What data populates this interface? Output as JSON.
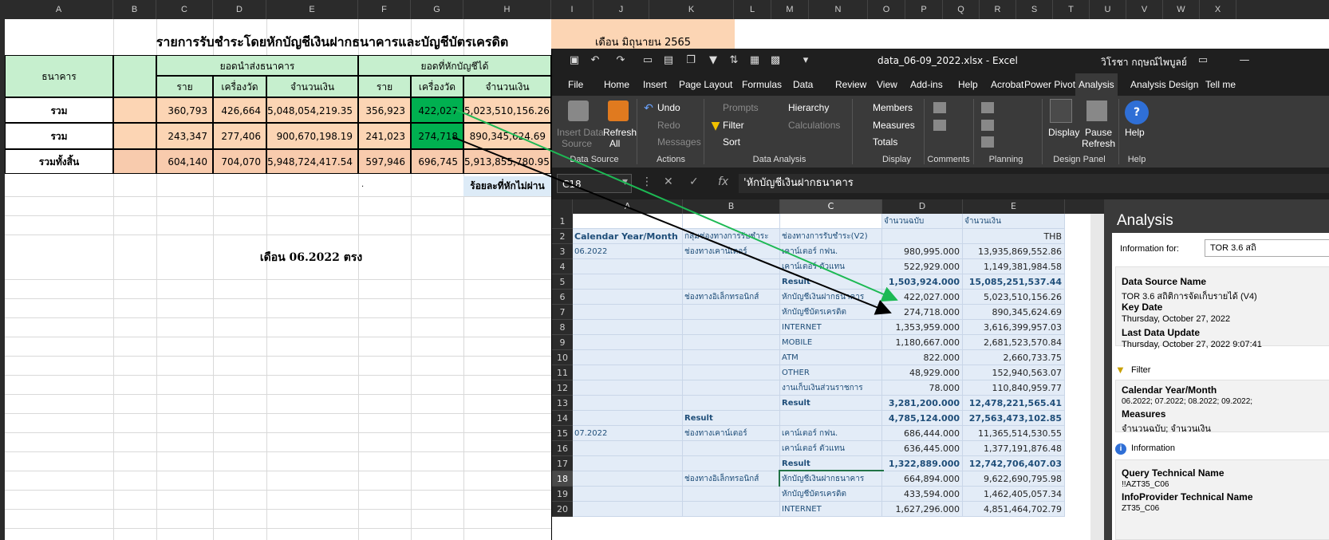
{
  "sheet": {
    "col_headers": [
      "A",
      "B",
      "C",
      "D",
      "E",
      "F",
      "G",
      "H",
      "I",
      "J",
      "K",
      "L",
      "M",
      "N",
      "O",
      "P",
      "Q",
      "R",
      "S",
      "T",
      "U",
      "V",
      "W",
      "X"
    ],
    "title": "รายการรับชำระโดยหักบัญชีเงินฝากธนาคารและบัญชีบัตรเครดิต",
    "month_box": "เดือน มิถุนายน  2565",
    "hdr_bank": "ธนาคาร",
    "hdr_sent": "ยอดนำส่งธนาคาร",
    "hdr_deducted": "ยอดที่หักบัญชีได้",
    "sub_rai": "ราย",
    "sub_machine": "เครื่องวัด",
    "sub_amount": "จำนวนเงิน",
    "rows": [
      {
        "label": "รวม",
        "c": "360,793",
        "d": "426,664",
        "e": "5,048,054,219.35",
        "f": "356,923",
        "g": "422,027",
        "h": "5,023,510,156.26"
      },
      {
        "label": "รวม",
        "c": "243,347",
        "d": "277,406",
        "e": "900,670,198.19",
        "f": "241,023",
        "g": "274,718",
        "h": "890,345,624.69"
      },
      {
        "label": "รวมทั้งสิ้น",
        "c": "604,140",
        "d": "704,070",
        "e": "5,948,724,417.54",
        "f": "597,946",
        "g": "696,745",
        "h": "5,913,855,780.95"
      }
    ],
    "fail_pct": "ร้อยละที่หักไม่ผ่าน",
    "dot": ".",
    "month_label": "เดือน 06.2022 ตรง"
  },
  "excel": {
    "title": "data_06-09_2022.xlsx  -  Excel",
    "user": "วิโรชา กฤษณ์ไพบูลย์",
    "tabs": [
      "File",
      "Home",
      "Insert",
      "Page Layout",
      "Formulas",
      "Data",
      "Review",
      "View",
      "Add-ins",
      "Help",
      "Acrobat",
      "Power Pivot",
      "Analysis",
      "Analysis Design",
      "Tell me"
    ],
    "ribbon": {
      "insert_data_source": "Insert Data",
      "insert_data_source2": "Source",
      "refresh_all": "Refresh",
      "refresh_all2": "All",
      "undo": "Undo",
      "redo": "Redo",
      "messages": "Messages",
      "prompts": "Prompts",
      "filter": "Filter",
      "sort": "Sort",
      "hierarchy": "Hierarchy",
      "calculations": "Calculations",
      "members": "Members",
      "measures": "Measures",
      "totals": "Totals",
      "display": "Display",
      "pause_refresh": "Pause",
      "pause_refresh2": "Refresh",
      "help": "Help",
      "groups": [
        "Data Source",
        "Actions",
        "Data Analysis",
        "Display",
        "Comments",
        "Planning",
        "Design Panel",
        "Help"
      ]
    },
    "namebox": "C18",
    "formula": "'หักบัญชีเงินฝากธนาคาร",
    "grid": {
      "cols": [
        "A",
        "B",
        "C",
        "D",
        "E"
      ],
      "d1": "จำนวนฉบับ",
      "e1": "จำนวนเงิน",
      "a2": "Calendar Year/Month",
      "b2": "กลุ่มช่องทางการรับชำระ",
      "c2": "ช่องทางการรับชำระ(V2)",
      "e2": "THB",
      "rows": [
        {
          "n": "3",
          "a": "06.2022",
          "b": "ช่องทางเคาน์เตอร์",
          "c": "เคาน์เตอร์ กฟน.",
          "d": "980,995.000",
          "e": "13,935,869,552.86"
        },
        {
          "n": "4",
          "a": "",
          "b": "",
          "c": "เคาน์เตอร์ ตัวแทน",
          "d": "522,929.000",
          "e": "1,149,381,984.58"
        },
        {
          "n": "5",
          "a": "",
          "b": "",
          "c": "Result",
          "d": "1,503,924.000",
          "e": "15,085,251,537.44",
          "res": true
        },
        {
          "n": "6",
          "a": "",
          "b": "ช่องทางอิเล็กทรอนิกส์",
          "c": "หักบัญชีเงินฝากธนาคาร",
          "d": "422,027.000",
          "e": "5,023,510,156.26"
        },
        {
          "n": "7",
          "a": "",
          "b": "",
          "c": "หักบัญชีบัตรเครดิต",
          "d": "274,718.000",
          "e": "890,345,624.69"
        },
        {
          "n": "8",
          "a": "",
          "b": "",
          "c": "INTERNET",
          "d": "1,353,959.000",
          "e": "3,616,399,957.03"
        },
        {
          "n": "9",
          "a": "",
          "b": "",
          "c": "MOBILE",
          "d": "1,180,667.000",
          "e": "2,681,523,570.84"
        },
        {
          "n": "10",
          "a": "",
          "b": "",
          "c": "ATM",
          "d": "822.000",
          "e": "2,660,733.75"
        },
        {
          "n": "11",
          "a": "",
          "b": "",
          "c": "OTHER",
          "d": "48,929.000",
          "e": "152,940,563.07"
        },
        {
          "n": "12",
          "a": "",
          "b": "",
          "c": "งานเก็บเงินส่วนราชการ",
          "d": "78.000",
          "e": "110,840,959.77"
        },
        {
          "n": "13",
          "a": "",
          "b": "",
          "c": "Result",
          "d": "3,281,200.000",
          "e": "12,478,221,565.41",
          "res": true
        },
        {
          "n": "14",
          "a": "",
          "b": "Result",
          "c": "",
          "d": "4,785,124.000",
          "e": "27,563,473,102.85",
          "res": true,
          "bres": true
        },
        {
          "n": "15",
          "a": "07.2022",
          "b": "ช่องทางเคาน์เตอร์",
          "c": "เคาน์เตอร์ กฟน.",
          "d": "686,444.000",
          "e": "11,365,514,530.55"
        },
        {
          "n": "16",
          "a": "",
          "b": "",
          "c": "เคาน์เตอร์ ตัวแทน",
          "d": "636,445.000",
          "e": "1,377,191,876.48"
        },
        {
          "n": "17",
          "a": "",
          "b": "",
          "c": "Result",
          "d": "1,322,889.000",
          "e": "12,742,706,407.03",
          "res": true
        },
        {
          "n": "18",
          "a": "",
          "b": "ช่องทางอิเล็กทรอนิกส์",
          "c": "หักบัญชีเงินฝากธนาคาร",
          "d": "664,894.000",
          "e": "9,622,690,795.98"
        },
        {
          "n": "19",
          "a": "",
          "b": "",
          "c": "หักบัญชีบัตรเครดิต",
          "d": "433,594.000",
          "e": "1,462,405,057.34"
        },
        {
          "n": "20",
          "a": "",
          "b": "",
          "c": "INTERNET",
          "d": "1,627,296.000",
          "e": "4,851,464,702.79"
        }
      ],
      "row1": "1",
      "row2": "2"
    },
    "analysis": {
      "title": "Analysis",
      "info_for": "Information for:",
      "info_for_value": "TOR 3.6 สถิ",
      "ds_name_label": "Data Source Name",
      "ds_name_value": "TOR  3.6 สถิติการจัดเก็บรายได้ (V4)",
      "key_date_label": "Key Date",
      "key_date_value": "Thursday, October 27, 2022",
      "last_update_label": "Last Data Update",
      "last_update_value": "Thursday, October 27, 2022 9:07:41",
      "filter_label": "Filter",
      "cym_label": "Calendar Year/Month",
      "cym_value": "06.2022; 07.2022; 08.2022; 09.2022;",
      "measures_label": "Measures",
      "measures_value": "จำนวนฉบับ; จำนวนเงิน",
      "information_label": "Information",
      "qtn_label": "Query Technical Name",
      "qtn_value": "!!AZT35_C06",
      "iptn_label": "InfoProvider Technical Name",
      "iptn_value": "ZT35_C06"
    }
  },
  "colors": {
    "green_arrow": "#1db954",
    "black_arrow": "#000000",
    "accent_green": "#00b050",
    "peach": "#fcd5b4"
  }
}
